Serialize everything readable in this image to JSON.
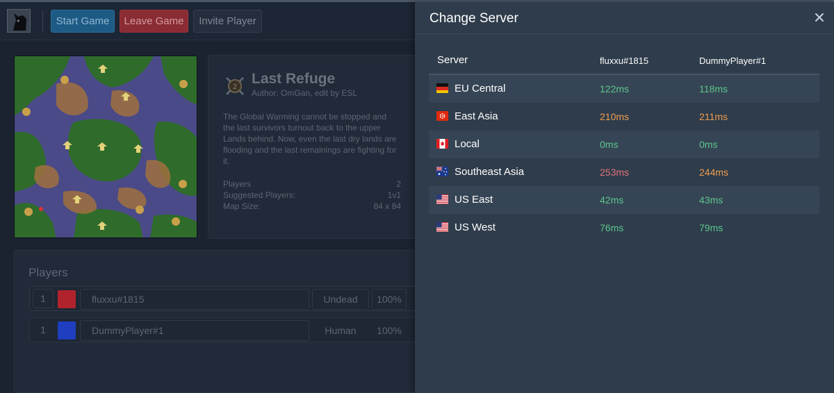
{
  "toolbar": {
    "start_label": "Start Game",
    "leave_label": "Leave Game",
    "invite_label": "Invite Player"
  },
  "map": {
    "title": "Last Refuge",
    "author": "Author: OmGan, edit by ESL",
    "badge_number": "2",
    "description": "The Global Warming cannot be stopped and the last survivors turnout back to the upper Lands behind. Now, even the last dry lands are flooding and the last remainings are fighting for it.",
    "stats": [
      {
        "label": "Players",
        "value": "2"
      },
      {
        "label": "Suggested Players:",
        "value": "1v1"
      },
      {
        "label": "Map Size:",
        "value": "84 x 84"
      }
    ]
  },
  "players": {
    "title": "Players",
    "rows": [
      {
        "team": "1",
        "color": "#b1232c",
        "name": "fluxxu#1815",
        "race": "Undead",
        "handicap": "100%"
      },
      {
        "team": "1",
        "color": "#1f3ec0",
        "name": "DummyPlayer#1",
        "race": "Human",
        "handicap": "100%"
      }
    ]
  },
  "modal": {
    "title": "Change Server",
    "close_icon": "×",
    "headers": {
      "server": "Server",
      "player1": "fluxxu#1815",
      "player2": "DummyPlayer#1"
    },
    "servers": [
      {
        "flag": "germany-flag-icon",
        "name": "EU Central",
        "ping1": "122ms",
        "ping2": "118ms",
        "level1": "good",
        "level2": "good"
      },
      {
        "flag": "hong-kong-flag-icon",
        "name": "East Asia",
        "ping1": "210ms",
        "ping2": "211ms",
        "level1": "mid",
        "level2": "mid"
      },
      {
        "flag": "canada-flag-icon",
        "name": "Local",
        "ping1": "0ms",
        "ping2": "0ms",
        "level1": "good",
        "level2": "good"
      },
      {
        "flag": "australia-flag-icon",
        "name": "Southeast Asia",
        "ping1": "253ms",
        "ping2": "244ms",
        "level1": "bad",
        "level2": "mid"
      },
      {
        "flag": "usa-flag-icon",
        "name": "US East",
        "ping1": "42ms",
        "ping2": "43ms",
        "level1": "good",
        "level2": "good"
      },
      {
        "flag": "usa-flag-icon",
        "name": "US West",
        "ping1": "76ms",
        "ping2": "79ms",
        "level1": "good",
        "level2": "good"
      }
    ]
  },
  "colors": {
    "ping_good": "#5dc68b",
    "ping_mid": "#ef9d4e",
    "ping_bad": "#e3737b"
  }
}
